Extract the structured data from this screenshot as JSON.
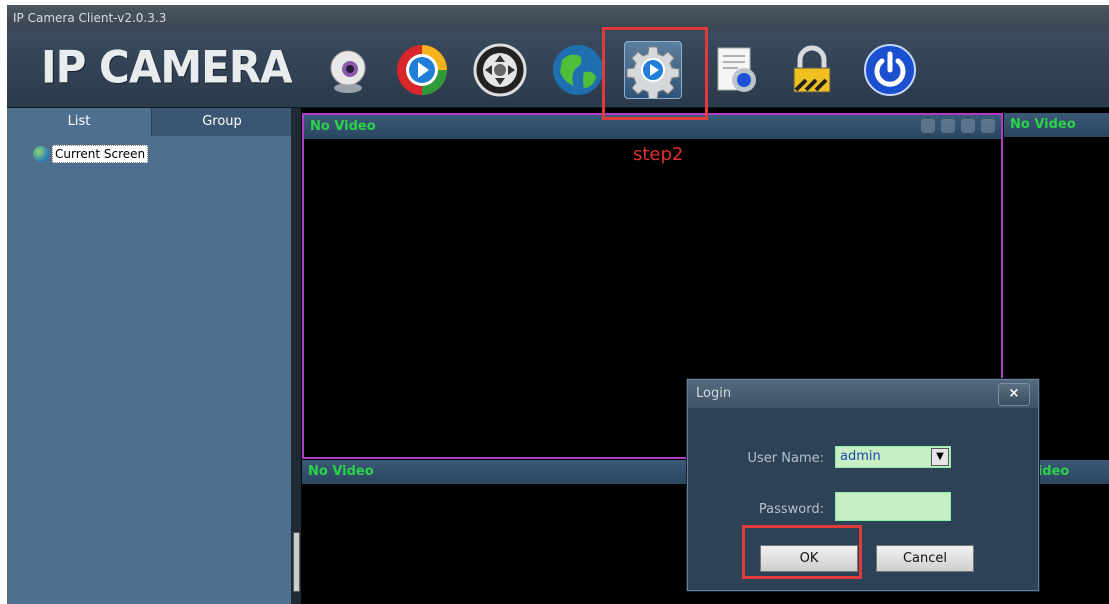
{
  "window": {
    "title": "IP Camera Client-v2.0.3.3"
  },
  "header": {
    "logo": "IP CAMERA",
    "toolbar": [
      "webcam-icon",
      "playback-icon",
      "ptz-control-icon",
      "network-globe-icon",
      "settings-gear-icon",
      "log-report-icon",
      "lock-icon",
      "power-icon"
    ]
  },
  "sidebar": {
    "tabs": [
      {
        "label": "List"
      },
      {
        "label": "Group"
      }
    ],
    "tree": [
      {
        "label": "Current Screen"
      }
    ]
  },
  "video": {
    "panels": [
      {
        "label": "No Video"
      },
      {
        "label": "No Video"
      },
      {
        "label": "No Video"
      },
      {
        "label": "Video"
      }
    ]
  },
  "annotation": {
    "step_label": "step2",
    "color": "#e03a3a"
  },
  "login_dialog": {
    "title": "Login",
    "close_label": "×",
    "username_label": "User Name:",
    "username_value": "admin",
    "password_label": "Password:",
    "ok_label": "OK",
    "cancel_label": "Cancel"
  }
}
